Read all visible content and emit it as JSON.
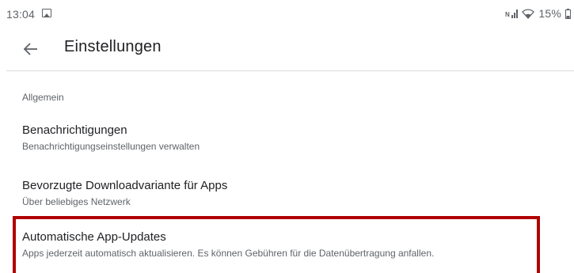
{
  "status_bar": {
    "time": "13:04",
    "image_icon": "image-icon",
    "signal_icon": "mobile-signal-icon",
    "wifi_icon": "wifi-icon",
    "battery_percent": "15%",
    "battery_icon": "battery-icon"
  },
  "toolbar": {
    "back_icon": "back-arrow-icon",
    "title": "Einstellungen"
  },
  "section": {
    "header": "Allgemein"
  },
  "settings": [
    {
      "title": "Benachrichtigungen",
      "subtitle": "Benachrichtigungseinstellungen verwalten"
    },
    {
      "title": "Bevorzugte Downloadvariante für Apps",
      "subtitle": "Über beliebiges Netzwerk"
    },
    {
      "title": "Automatische App-Updates",
      "subtitle": "Apps jederzeit automatisch aktualisieren. Es können Gebühren für die Datenübertragung anfallen."
    }
  ],
  "colors": {
    "highlight_border": "#b00000",
    "text_primary": "#202124",
    "text_secondary": "#5f6368",
    "divider": "#dadce0"
  }
}
